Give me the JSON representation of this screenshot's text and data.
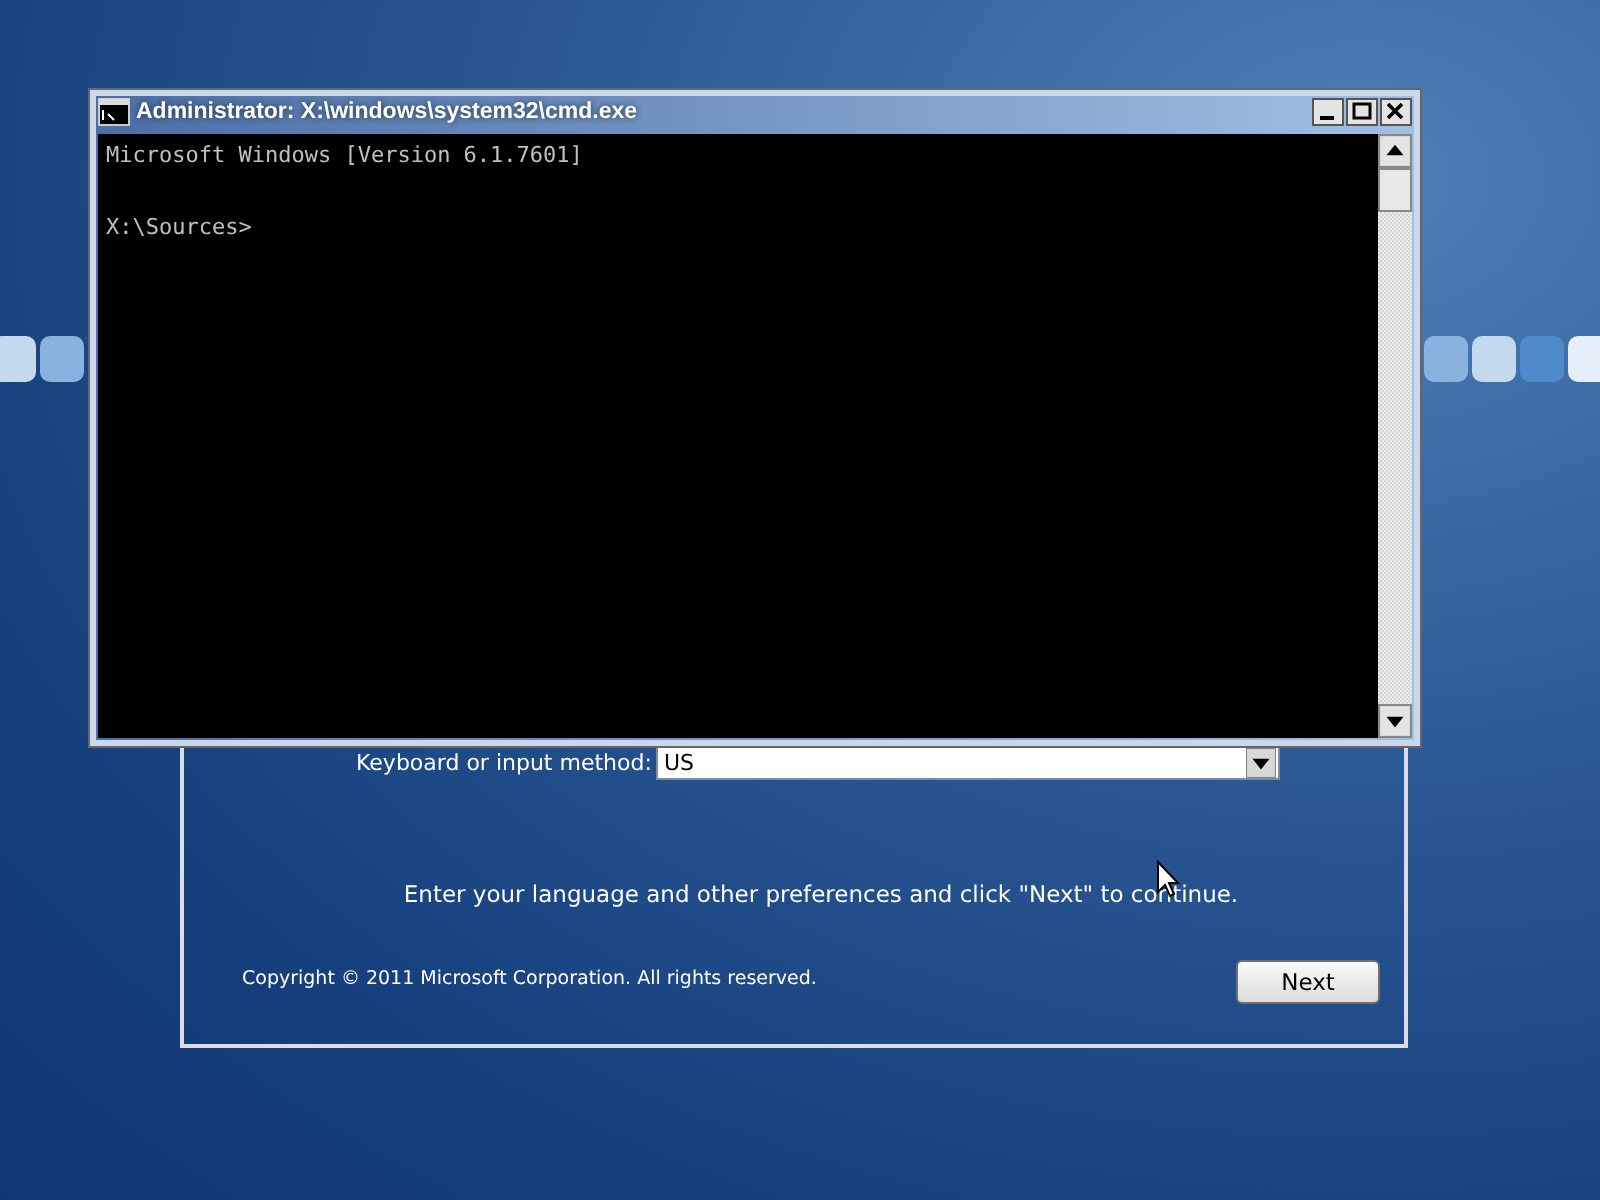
{
  "setup_dialog": {
    "keyboard_label": "Keyboard or input method:",
    "keyboard_value": "US",
    "instruction": "Enter your language and other preferences and click \"Next\" to continue.",
    "copyright": "Copyright © 2011 Microsoft Corporation. All rights reserved.",
    "next_button": "Next"
  },
  "console_window": {
    "title": "Administrator: X:\\windows\\system32\\cmd.exe",
    "output": "Microsoft Windows [Version 6.1.7601]",
    "prompt": "X:\\Sources>"
  }
}
